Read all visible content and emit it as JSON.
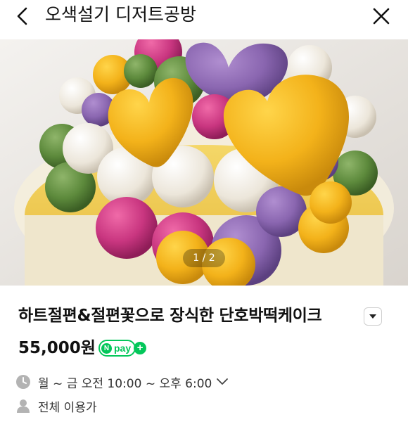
{
  "header": {
    "back_icon": "back-chevron-icon",
    "title": "오색설기 디저트공방",
    "close_icon": "close-icon"
  },
  "gallery": {
    "current_page": 1,
    "total_pages": 2,
    "indicator": "1 / 2"
  },
  "product": {
    "title": "하트절편&절편꽃으로 장식한 단호박떡케이크",
    "dropdown_icon": "caret-down-icon",
    "price": "55,000원",
    "npay": {
      "n": "N",
      "label": "pay",
      "plus": "+",
      "color": "#03c75a"
    }
  },
  "info": {
    "hours": {
      "icon": "clock-icon",
      "text": "월 ~ 금 오전 10:00 ~ 오후 6:00",
      "expand_icon": "chevron-down-icon"
    },
    "audience": {
      "icon": "person-icon",
      "text": "전체 이용가"
    }
  }
}
